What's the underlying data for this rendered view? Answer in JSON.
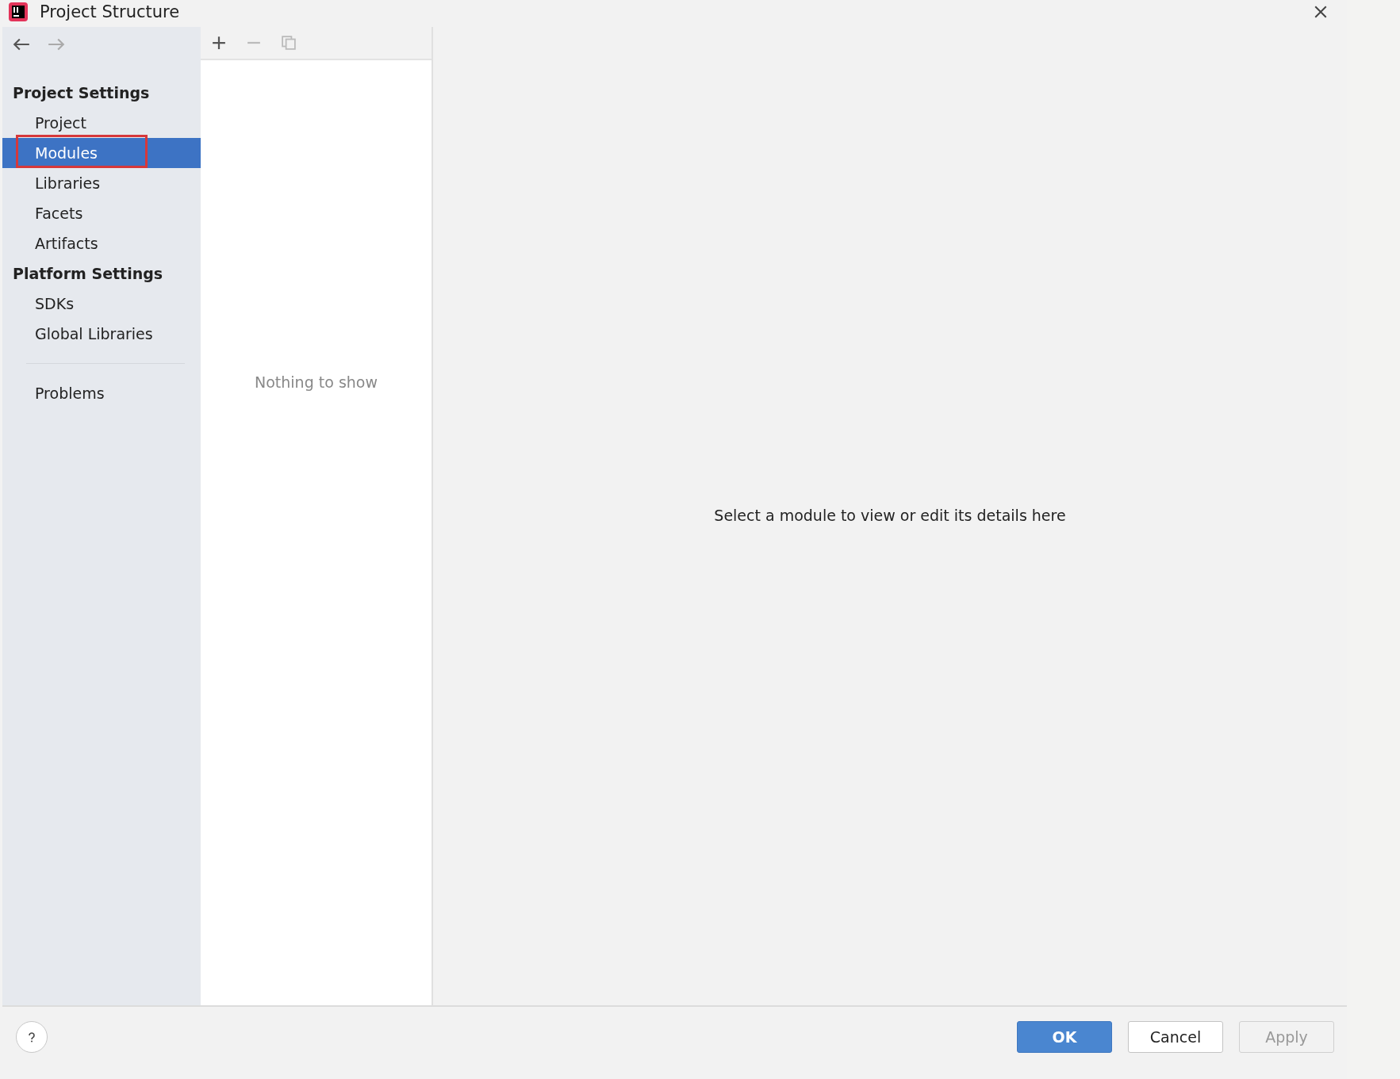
{
  "window": {
    "title": "Project Structure"
  },
  "sidebar": {
    "sections": [
      {
        "kind": "header",
        "label": "Project Settings"
      },
      {
        "kind": "item",
        "label": "Project",
        "selected": false,
        "highlighted": false
      },
      {
        "kind": "item",
        "label": "Modules",
        "selected": true,
        "highlighted": true
      },
      {
        "kind": "item",
        "label": "Libraries",
        "selected": false,
        "highlighted": false
      },
      {
        "kind": "item",
        "label": "Facets",
        "selected": false,
        "highlighted": false
      },
      {
        "kind": "item",
        "label": "Artifacts",
        "selected": false,
        "highlighted": false
      },
      {
        "kind": "header",
        "label": "Platform Settings"
      },
      {
        "kind": "item",
        "label": "SDKs",
        "selected": false,
        "highlighted": false
      },
      {
        "kind": "item",
        "label": "Global Libraries",
        "selected": false,
        "highlighted": false
      },
      {
        "kind": "divider"
      },
      {
        "kind": "item",
        "label": "Problems",
        "selected": false,
        "highlighted": false
      }
    ]
  },
  "list": {
    "toolbar": [
      {
        "kind": "add",
        "disabled": false
      },
      {
        "kind": "remove",
        "disabled": true
      },
      {
        "kind": "copy",
        "disabled": true
      }
    ],
    "empty_text": "Nothing to show"
  },
  "details": {
    "message": "Select a module to view or edit its details here"
  },
  "buttons": [
    {
      "label": "OK",
      "kind": "primary",
      "disabled": false
    },
    {
      "label": "Cancel",
      "kind": "normal",
      "disabled": false
    },
    {
      "label": "Apply",
      "kind": "normal",
      "disabled": true
    }
  ]
}
